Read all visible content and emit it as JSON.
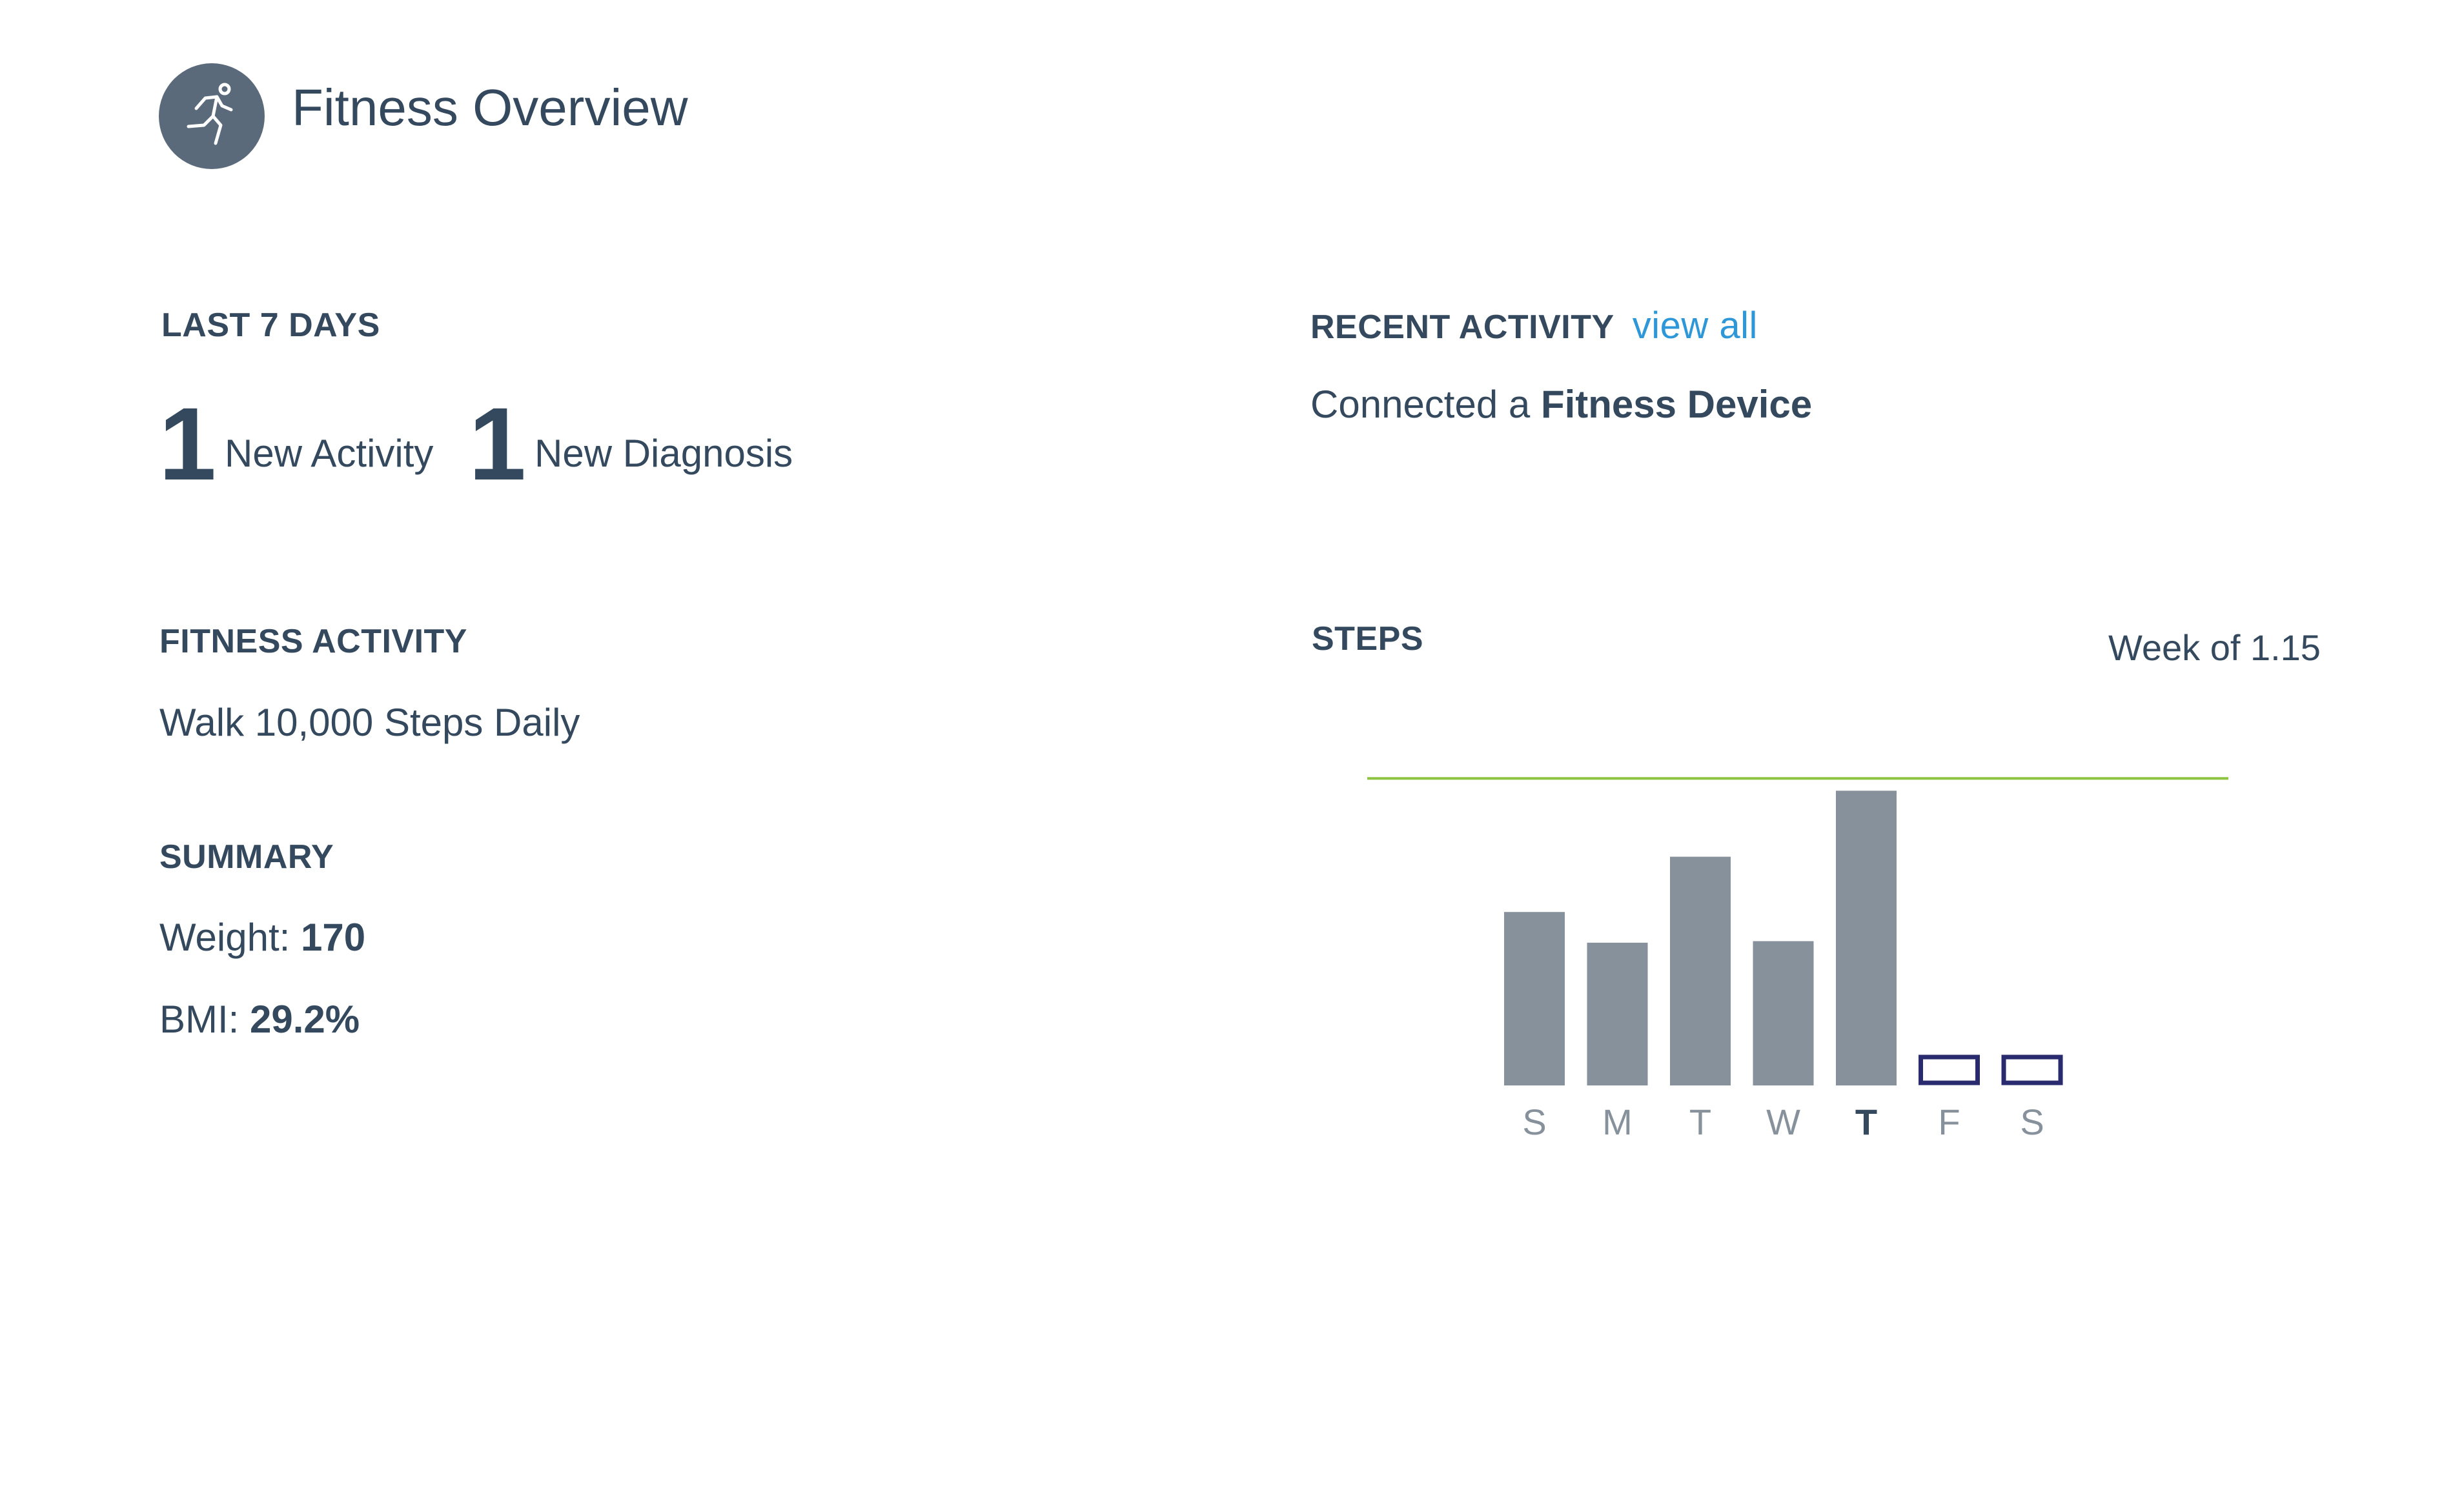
{
  "header": {
    "title": "Fitness Overview",
    "logo_icon": "running-person-icon"
  },
  "last7": {
    "label": "LAST 7 DAYS",
    "activity_count": "1",
    "activity_label": "New Activity",
    "diagnosis_count": "1",
    "diagnosis_label": "New Diagnosis"
  },
  "recent": {
    "label": "RECENT ACTIVITY",
    "view_all": "view all",
    "item_prefix": "Connected a",
    "item_bold": "Fitness Device"
  },
  "fitness": {
    "label": "FITNESS ACTIVITY",
    "goal": "Walk 10,000 Steps Daily"
  },
  "summary": {
    "label": "SUMMARY",
    "weight_label": "Weight:",
    "weight_value": "170",
    "bmi_label": "BMI:",
    "bmi_value": "29.2%"
  },
  "steps": {
    "label": "STEPS",
    "week": "Week of 1.15"
  },
  "colors": {
    "bar": "#87919c",
    "empty_bar_stroke": "#2a2a6e",
    "goal_line": "#8cc43f",
    "link": "#2e97d8",
    "text": "#34495e"
  },
  "chart_data": {
    "type": "bar",
    "categories": [
      "S",
      "M",
      "T",
      "W",
      "T",
      "F",
      "S"
    ],
    "values": [
      5650,
      4650,
      7450,
      4700,
      9600,
      0,
      0
    ],
    "recorded": [
      true,
      true,
      true,
      true,
      true,
      false,
      false
    ],
    "highlight_index": 4,
    "goal": 10000,
    "ylim": [
      0,
      10300
    ]
  }
}
